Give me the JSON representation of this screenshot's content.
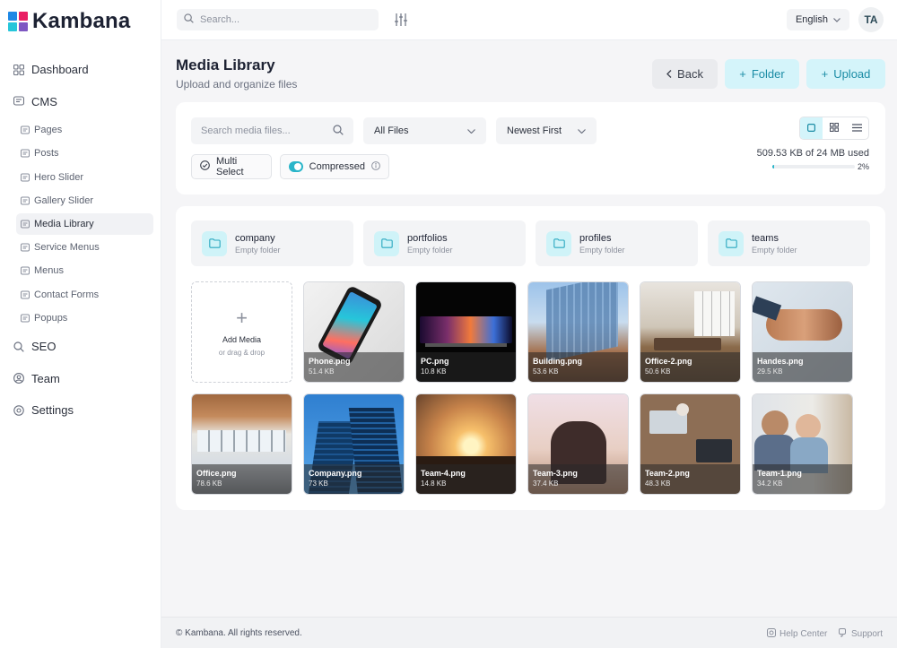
{
  "brand": {
    "name": "Kambana"
  },
  "colors": {
    "accent": "#2ab5c9",
    "accent_light": "#d4f4fa",
    "brand_blue": "#1e88e5",
    "brand_pink": "#e91e63",
    "brand_cyan": "#26c6da",
    "brand_purple": "#7e57c2"
  },
  "topbar": {
    "search_placeholder": "Search...",
    "language": "English",
    "avatar_initials": "TA"
  },
  "sidebar": {
    "items": [
      {
        "label": "Dashboard",
        "icon": "grid-icon"
      },
      {
        "label": "CMS",
        "icon": "cms-icon"
      },
      {
        "label": "SEO",
        "icon": "search-icon"
      },
      {
        "label": "Team",
        "icon": "team-icon"
      },
      {
        "label": "Settings",
        "icon": "gear-icon"
      }
    ],
    "cms_children": [
      "Pages",
      "Posts",
      "Hero Slider",
      "Gallery Slider",
      "Media Library",
      "Service Menus",
      "Menus",
      "Contact Forms",
      "Popups"
    ],
    "active": "Media Library"
  },
  "header": {
    "title": "Media Library",
    "subtitle": "Upload and organize files",
    "back_label": "Back",
    "folder_label": "Folder",
    "upload_label": "Upload"
  },
  "filters": {
    "search_placeholder": "Search media files...",
    "type_value": "All Files",
    "sort_value": "Newest First",
    "multi_select_label": "Multi Select",
    "compressed_label": "Compressed",
    "compressed_on": true,
    "storage_text": "509.53 KB of 24 MB used",
    "storage_percent_label": "2%",
    "storage_fraction": 0.02,
    "view_mode": "square"
  },
  "folders": [
    {
      "name": "company",
      "meta": "Empty folder"
    },
    {
      "name": "portfolios",
      "meta": "Empty folder"
    },
    {
      "name": "profiles",
      "meta": "Empty folder"
    },
    {
      "name": "teams",
      "meta": "Empty folder"
    }
  ],
  "add_media": {
    "title": "Add Media",
    "subtitle": "or drag & drop"
  },
  "files": [
    {
      "name": "Phone.png",
      "size": "51.4 KB"
    },
    {
      "name": "PC.png",
      "size": "10.8 KB"
    },
    {
      "name": "Building.png",
      "size": "53.6 KB"
    },
    {
      "name": "Office-2.png",
      "size": "50.6 KB"
    },
    {
      "name": "Handes.png",
      "size": "29.5 KB"
    },
    {
      "name": "Office.png",
      "size": "78.6 KB"
    },
    {
      "name": "Company.png",
      "size": "73 KB"
    },
    {
      "name": "Team-4.png",
      "size": "14.8 KB"
    },
    {
      "name": "Team-3.png",
      "size": "37.4 KB"
    },
    {
      "name": "Team-2.png",
      "size": "48.3 KB"
    },
    {
      "name": "Team-1.png",
      "size": "34.2 KB"
    }
  ],
  "footer": {
    "copyright": "© Kambana. All rights reserved.",
    "help": "Help Center",
    "support": "Support"
  }
}
